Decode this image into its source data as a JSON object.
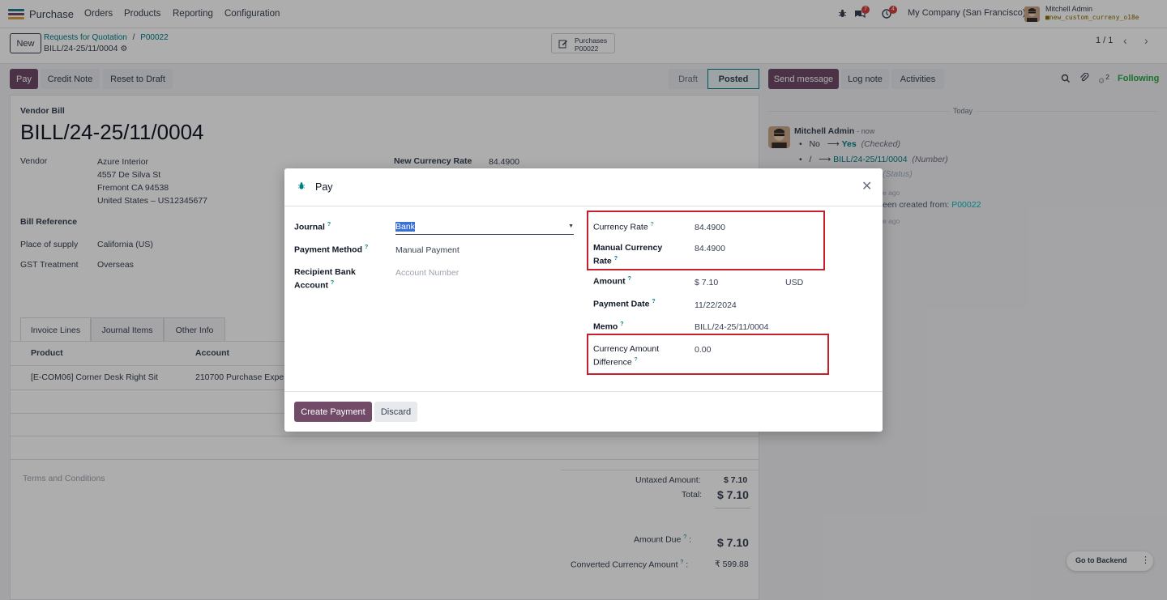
{
  "navbar": {
    "app_name": "Purchase",
    "menu": [
      "Orders",
      "Products",
      "Reporting",
      "Configuration"
    ],
    "chat_count": "7",
    "activity_count": "4",
    "company": "My Company (San Francisco)",
    "user_name": "Mitchell Admin",
    "db_name": "new_custom_curreny_o18e"
  },
  "control": {
    "new_label": "New",
    "crumb_parent": "Requests for Quotation",
    "crumb_sep": "/",
    "crumb_po": "P00022",
    "record_name": "BILL/24-25/11/0004",
    "smart_label": "Purchases",
    "smart_value": "P00022",
    "pager": "1 / 1"
  },
  "actions": {
    "pay": "Pay",
    "credit_note": "Credit Note",
    "reset": "Reset to Draft",
    "status_draft": "Draft",
    "status_posted": "Posted"
  },
  "form": {
    "doc_type": "Vendor Bill",
    "title": "BILL/24-25/11/0004",
    "vendor_label": "Vendor",
    "vendor_name": "Azure Interior",
    "vendor_addr1": "4557 De Silva St",
    "vendor_addr2": "Fremont CA 94538",
    "vendor_addr3": "United States – US12345677",
    "rate_label": "New Currency Rate",
    "rate_value": "84.4900",
    "bill_ref_label": "Bill Reference",
    "supply_label": "Place of supply",
    "supply_value": "California (US)",
    "gst_label": "GST Treatment",
    "gst_value": "Overseas",
    "tabs": [
      "Invoice Lines",
      "Journal Items",
      "Other Info"
    ],
    "col_product": "Product",
    "col_account": "Account",
    "line_product": "[E-COM06] Corner Desk Right Sit",
    "line_account": "210700 Purchase Expe",
    "terms": "Terms and Conditions",
    "untaxed_label": "Untaxed Amount:",
    "untaxed_value": "$ 7.10",
    "total_label": "Total:",
    "total_value": "$ 7.10",
    "due_label": "Amount Due",
    "due_value": "$ 7.10",
    "converted_label": "Converted Currency Amount",
    "converted_value": "₹ 599.88"
  },
  "chatter": {
    "send_message": "Send message",
    "log_note": "Log note",
    "activities": "Activities",
    "followers_count": "2",
    "following": "Following",
    "date_sep": "Today",
    "author": "Mitchell Admin",
    "time": "- now",
    "track1_old": "No",
    "track1_new": "Yes",
    "track1_field": "(Checked)",
    "track2_old": "/",
    "track2_new": "BILL/24-25/11/0004",
    "track2_field": "(Number)",
    "track3_field": "(Status)",
    "ago1": "e ago",
    "created_text": "een created from:",
    "created_link": "P00022",
    "ago2": "e ago"
  },
  "modal": {
    "title": "Pay",
    "journal_label": "Journal",
    "journal_value": "Bank",
    "method_label": "Payment Method",
    "method_value": "Manual Payment",
    "bank_label_1": "Recipient Bank",
    "bank_label_2": "Account",
    "bank_placeholder": "Account Number",
    "currency_rate_label": "Currency Rate",
    "currency_rate_value": "84.4900",
    "manual_rate_label_1": "Manual Currency",
    "manual_rate_label_2": "Rate",
    "manual_rate_value": "84.4900",
    "amount_label": "Amount",
    "amount_value": "$ 7.10",
    "amount_currency": "USD",
    "date_label": "Payment Date",
    "date_value": "11/22/2024",
    "memo_label": "Memo",
    "memo_value": "BILL/24-25/11/0004",
    "diff_label_1": "Currency Amount",
    "diff_label_2": "Difference",
    "diff_value": "0.00",
    "create_btn": "Create Payment",
    "discard_btn": "Discard",
    "help": "?"
  },
  "footer": {
    "go_backend": "Go to Backend"
  }
}
